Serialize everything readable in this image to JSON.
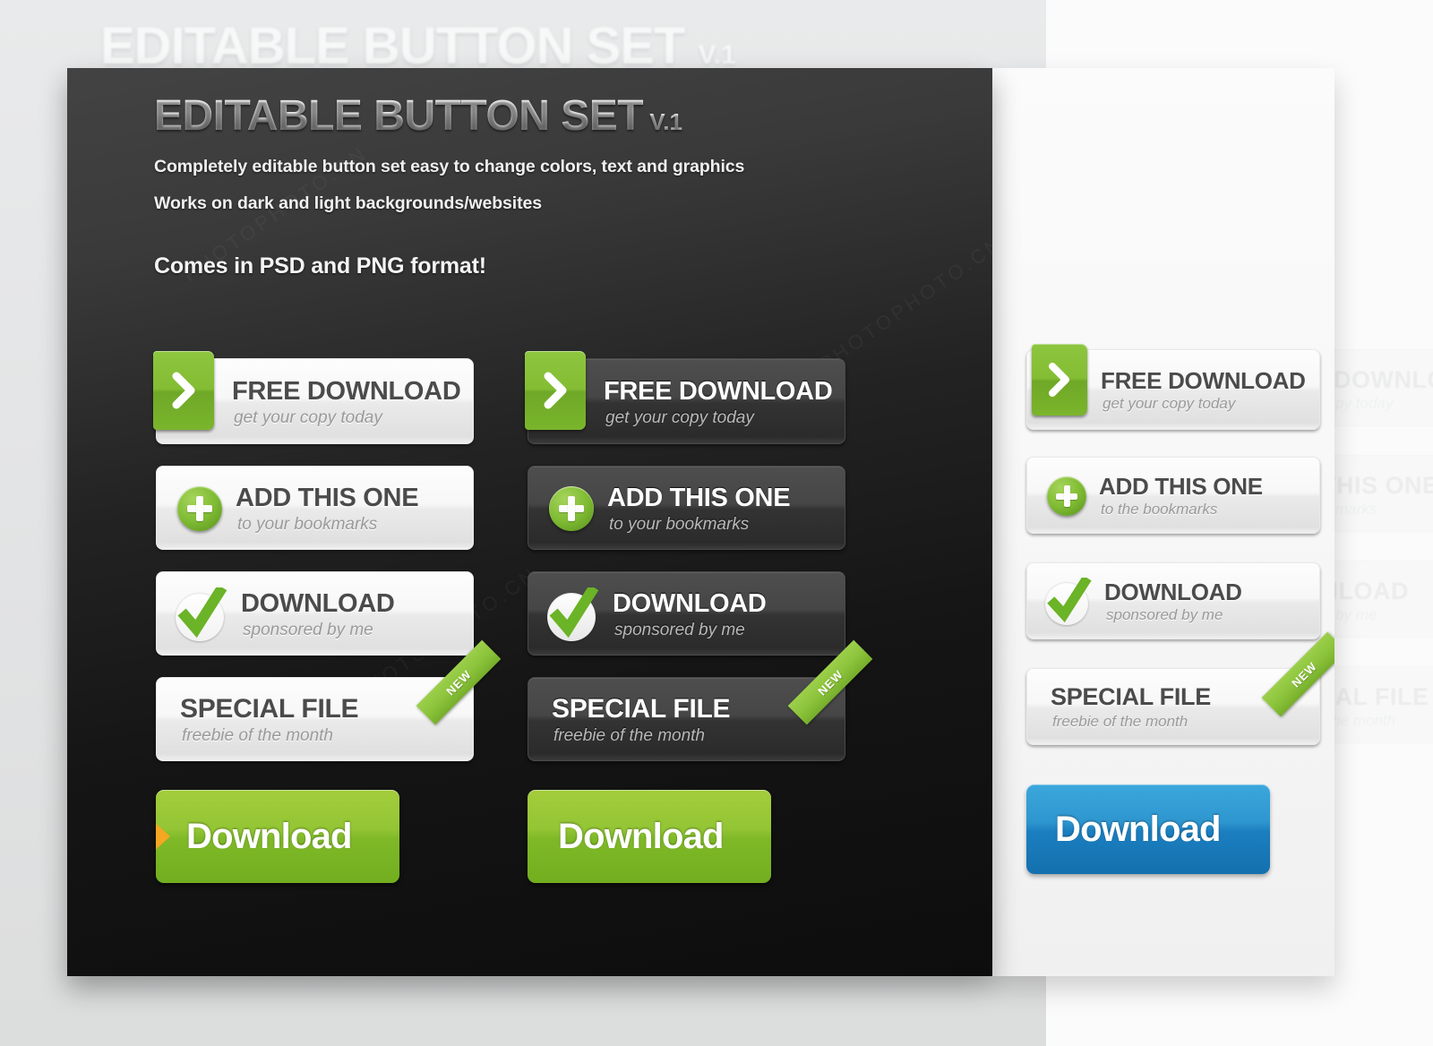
{
  "page": {
    "background_color": "#e4e5e6",
    "dark_panel_color": "#232323",
    "light_panel_color": "#f7f7f7",
    "accent_green": "#8cc43c",
    "accent_blue": "#1b7fc0",
    "accent_orange": "#f5a623"
  },
  "header": {
    "title": "EDITABLE BUTTON SET",
    "version": "V.1",
    "line1": "Completely editable button set easy to change colors, text and graphics",
    "line2": "Works on dark and light backgrounds/websites",
    "format_line": "Comes in PSD and PNG format!"
  },
  "ghost": {
    "title": "EDITABLE BUTTON SET",
    "version": "V.1",
    "buttons": [
      {
        "title": "FREE DOWNLOAD",
        "sub": "get your copy today"
      },
      {
        "title": "ADD THIS ONE",
        "sub": "to the bookmarks"
      },
      {
        "title": "DOWNLOAD",
        "sub": "sponsored by me"
      },
      {
        "title": "SPECIAL FILE",
        "sub": "freebie of the month"
      }
    ]
  },
  "columns": {
    "light_on_dark": {
      "style": "light",
      "buttons": [
        {
          "title": "FREE DOWNLOAD",
          "sub": "get your copy today",
          "icon": "chevron-right-icon"
        },
        {
          "title": "ADD THIS ONE",
          "sub": "to your bookmarks",
          "icon": "plus-circle-icon"
        },
        {
          "title": "DOWNLOAD",
          "sub": "sponsored by me",
          "icon": "check-circle-icon"
        },
        {
          "title": "SPECIAL FILE",
          "sub": "freebie of the month",
          "icon": "none",
          "ribbon": "NEW"
        }
      ],
      "solid": {
        "label": "Download",
        "color": "green",
        "arrow": true
      }
    },
    "dark_on_dark": {
      "style": "dark",
      "buttons": [
        {
          "title": "FREE DOWNLOAD",
          "sub": "get your copy today",
          "icon": "chevron-right-icon"
        },
        {
          "title": "ADD THIS ONE",
          "sub": "to your bookmarks",
          "icon": "plus-circle-icon"
        },
        {
          "title": "DOWNLOAD",
          "sub": "sponsored by me",
          "icon": "check-circle-icon"
        },
        {
          "title": "SPECIAL FILE",
          "sub": "freebie of the month",
          "icon": "none",
          "ribbon": "NEW"
        }
      ],
      "solid": {
        "label": "Download",
        "color": "green",
        "arrow": false
      }
    },
    "light_on_light": {
      "style": "light",
      "buttons": [
        {
          "title": "FREE DOWNLOAD",
          "sub": "get your copy today",
          "icon": "chevron-right-icon"
        },
        {
          "title": "ADD THIS ONE",
          "sub": "to the bookmarks",
          "icon": "plus-circle-icon"
        },
        {
          "title": "DOWNLOAD",
          "sub": "sponsored by me",
          "icon": "check-circle-icon"
        },
        {
          "title": "SPECIAL FILE",
          "sub": "freebie of the month",
          "icon": "none",
          "ribbon": "NEW"
        }
      ],
      "solid": {
        "label": "Download",
        "color": "blue",
        "arrow": false
      }
    }
  },
  "watermark": {
    "text": "PHOTOPHOTO.CN"
  }
}
